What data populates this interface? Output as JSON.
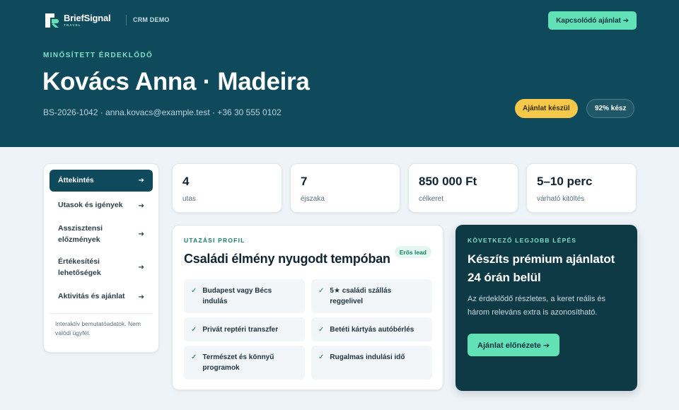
{
  "header": {
    "logo_name": "BriefSignal",
    "logo_sub": "TRAVEL",
    "crm_label": "CRM DEMO",
    "related_offer_button": "Kapcsolódó ajánlat ➔",
    "eyebrow": "MINŐSÍTETT ÉRDEKLŐDŐ",
    "title": "Kovács Anna · Madeira",
    "contact": "BS-2026-1042 · anna.kovacs@example.test · +36 30 555 0102",
    "status_badge": "Ajánlat készül",
    "progress_badge": "92% kész"
  },
  "sidebar": {
    "items": [
      {
        "label": "Áttekintés",
        "active": true
      },
      {
        "label": "Utasok és igények",
        "active": false
      },
      {
        "label": "Asszisztensi előzmények",
        "active": false
      },
      {
        "label": "Értékesítési lehetőségek",
        "active": false
      },
      {
        "label": "Aktivitás és ajánlat",
        "active": false
      }
    ],
    "note": "Interaktív bemutatóadatok. Nem valódi ügyfél."
  },
  "stats": [
    {
      "value": "4",
      "label": "utas"
    },
    {
      "value": "7",
      "label": "éjszaka"
    },
    {
      "value": "850 000 Ft",
      "label": "célkeret"
    },
    {
      "value": "5–10 perc",
      "label": "várható kitöltés"
    }
  ],
  "profile": {
    "eyebrow": "UTAZÁSI PROFIL",
    "title": "Családi élmény nyugodt tempóban",
    "badge": "Erős lead",
    "items": [
      "Budapest vagy Bécs indulás",
      "5★ családi szállás reggelivel",
      "Privát reptéri transzfer",
      "Betéti kártyás autóbérlés",
      "Természet és könnyű programok",
      "Rugalmas indulási idő"
    ]
  },
  "next_step": {
    "eyebrow": "KÖVETKEZŐ LEGJOBB LÉPÉS",
    "title": "Készíts prémium ajánlatot 24 órán belül",
    "description": "Az érdeklődő részletes, a keret reális és három releváns extra is azonosítható.",
    "button": "Ajánlat előnézete ➔"
  },
  "colors": {
    "hero_bg": "#0f4a5c",
    "accent": "#62e0b6",
    "status": "#f5c84a",
    "next_step_bg": "#0e3a45"
  }
}
